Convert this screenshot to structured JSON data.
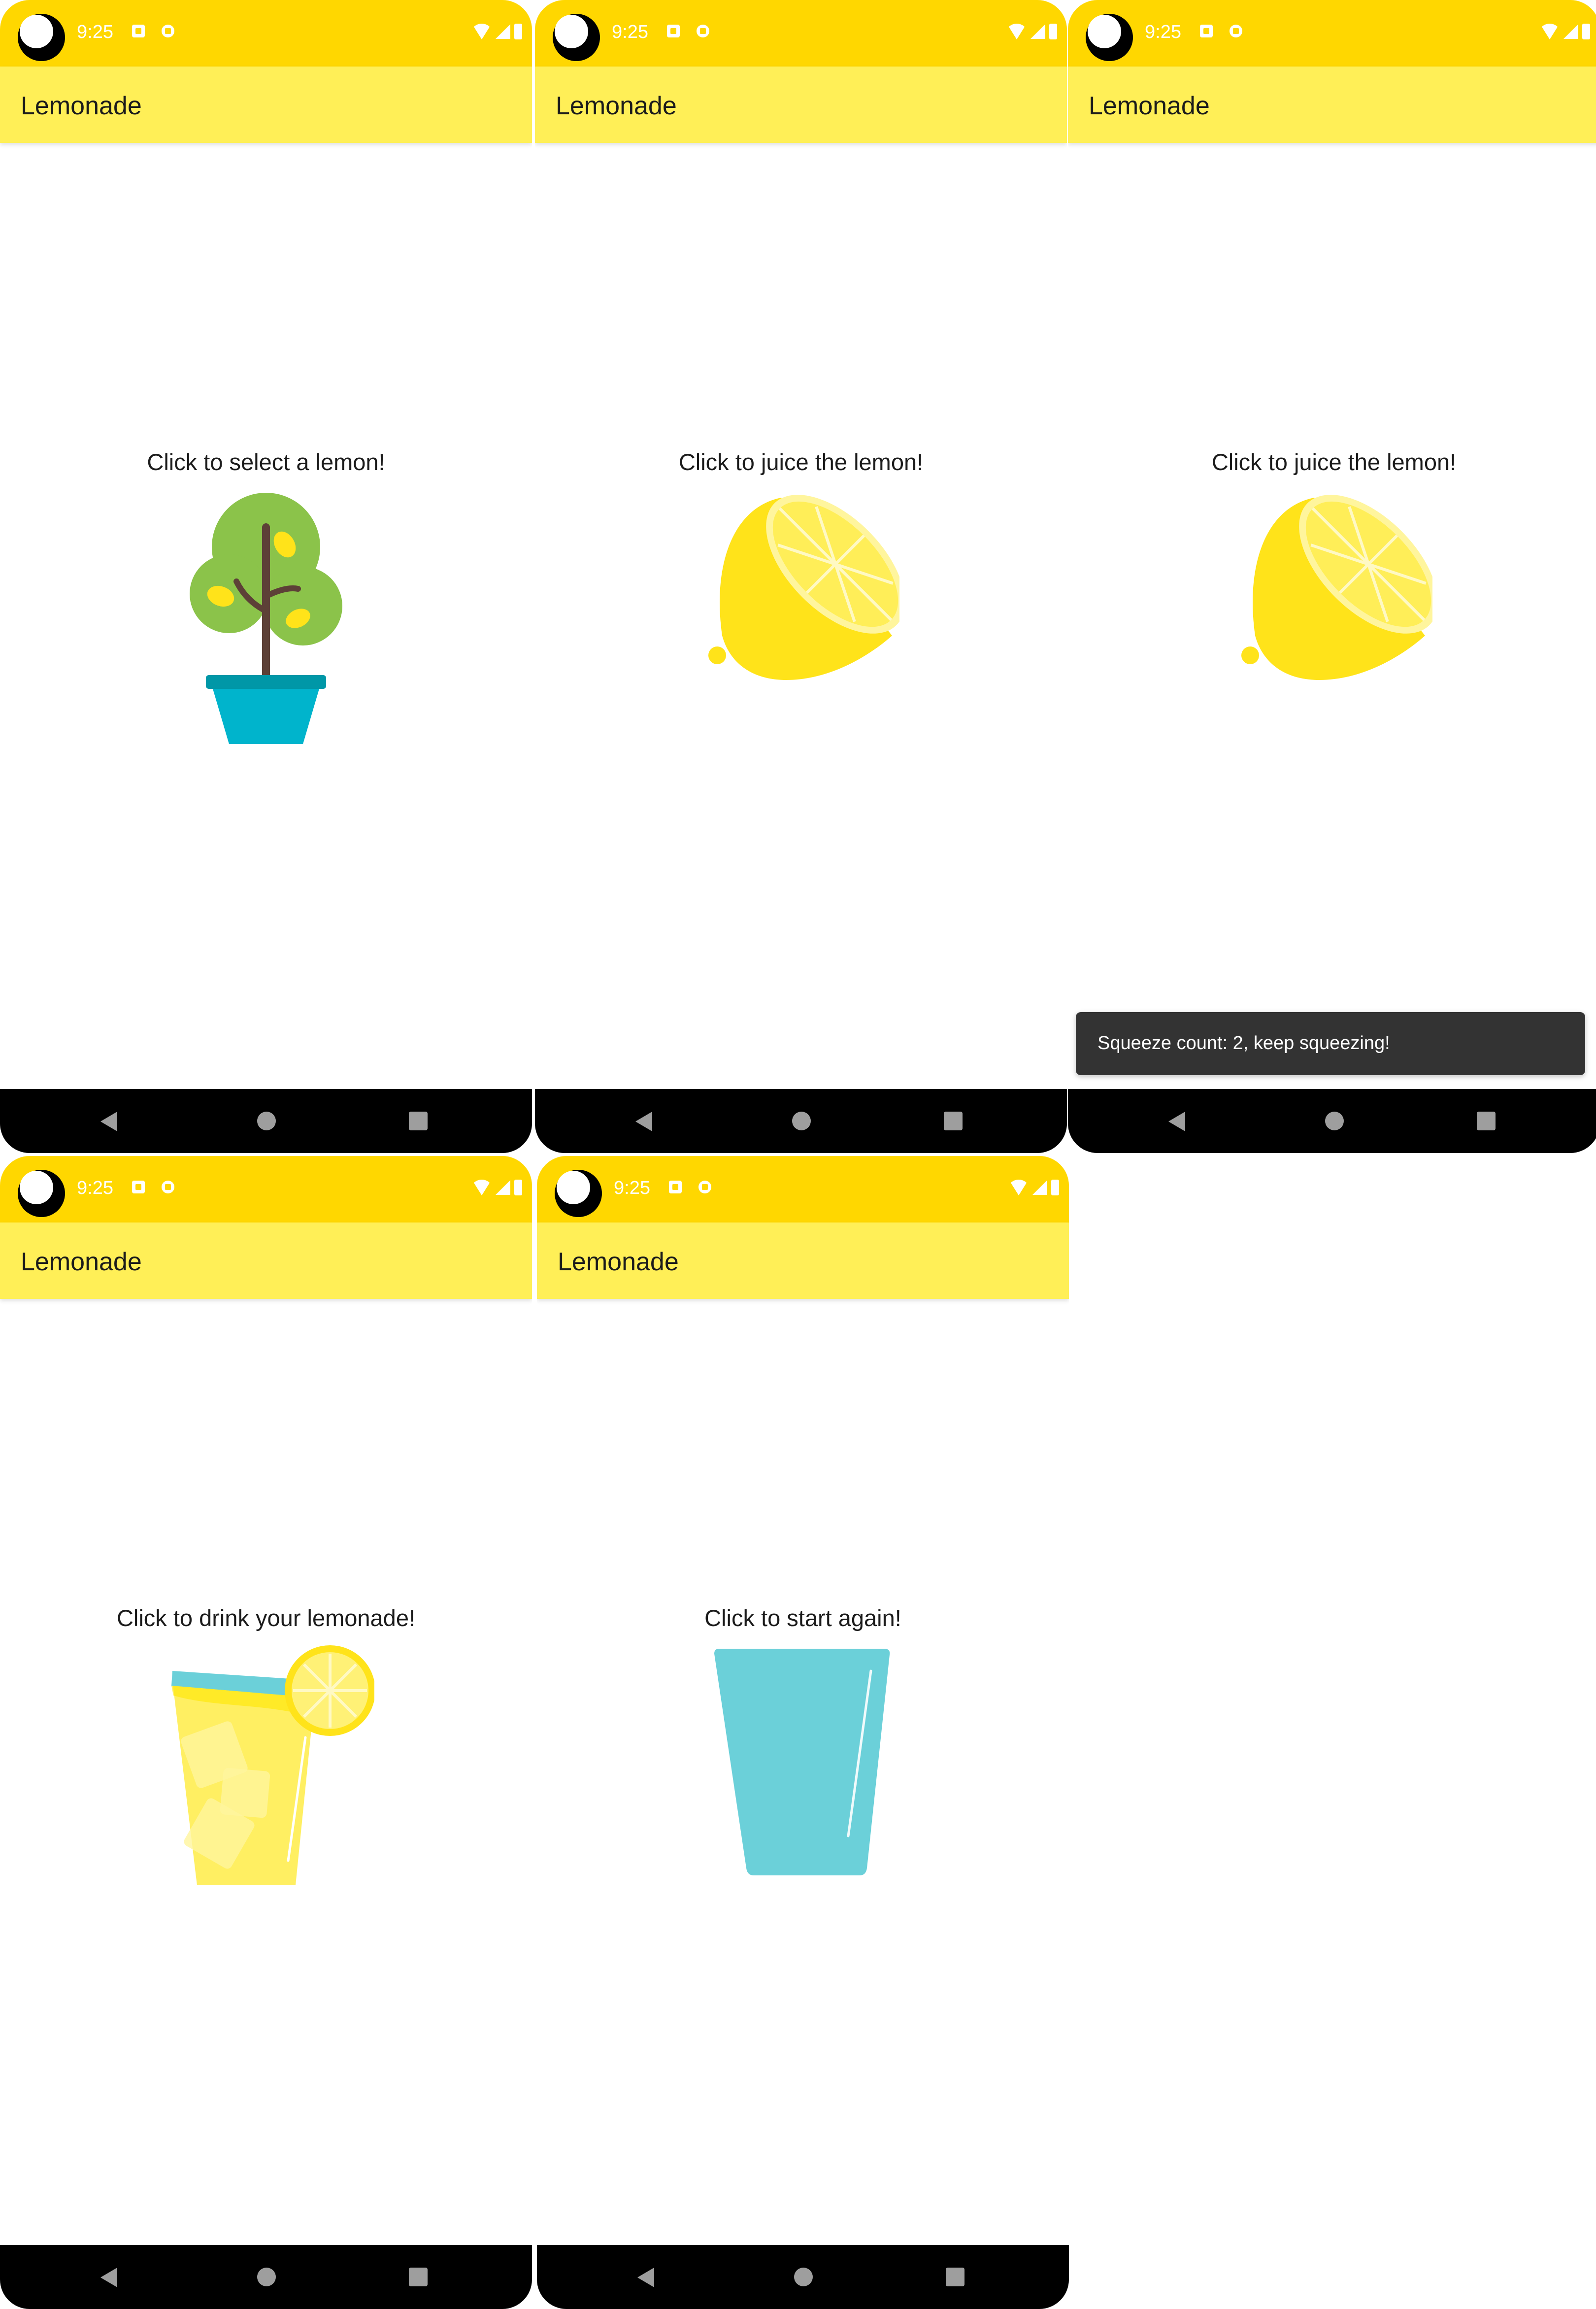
{
  "status_bar": {
    "time": "9:25"
  },
  "app_title": "Lemonade",
  "screens": [
    {
      "instruction": "Click to select a lemon!",
      "image": "lemon-tree-icon"
    },
    {
      "instruction": "Click to juice the lemon!",
      "image": "lemon-squeeze-icon"
    },
    {
      "instruction": "Click to juice the lemon!",
      "image": "lemon-squeeze-icon"
    },
    {
      "instruction": "Click to drink your lemonade!",
      "image": "lemonade-drink-icon"
    },
    {
      "instruction": "Click to start again!",
      "image": "empty-glass-icon"
    }
  ],
  "snackbar": {
    "text": "Squeeze count: 2, keep squeezing!"
  },
  "colors": {
    "status_bar": "#FFD700",
    "app_bar": "#FFEF57",
    "lemon": "#FFE31A",
    "glass": "#6BD0D9",
    "tree_leaves": "#8BC34A",
    "pot": "#00B4CC"
  },
  "nav": {
    "back": "back-icon",
    "home": "home-icon",
    "recents": "recents-icon"
  }
}
